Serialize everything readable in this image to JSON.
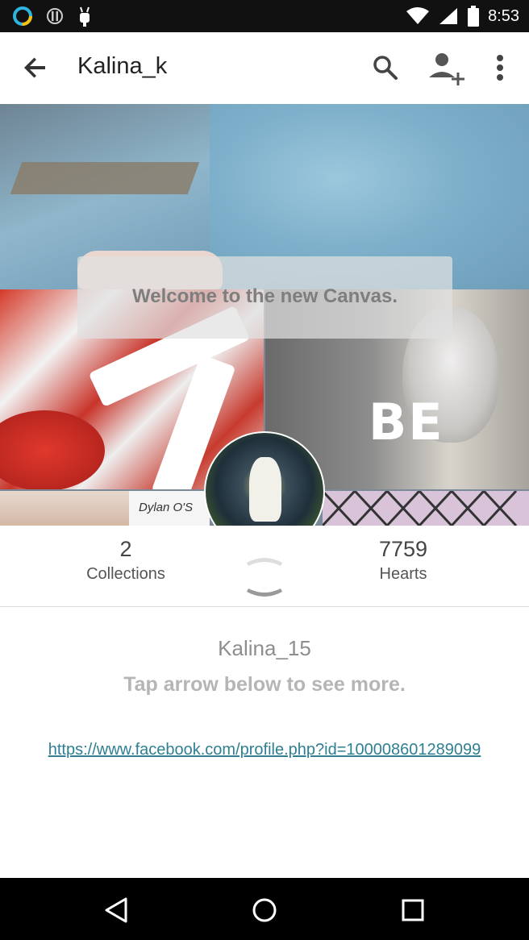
{
  "status_bar": {
    "time": "8:53",
    "icons": [
      "assistant-ring-icon",
      "sync-alert-icon",
      "android-debug-icon",
      "wifi-icon",
      "signal-icon",
      "battery-icon"
    ]
  },
  "app_bar": {
    "title": "Kalina_k",
    "icons": [
      "back-arrow-icon",
      "search-icon",
      "add-user-icon",
      "more-vert-icon"
    ]
  },
  "cover": {
    "overlay_text": "Welcome to the new Canvas.",
    "collage_texts": [
      "BE",
      "Dylan O'S"
    ]
  },
  "stats": {
    "collections_count": "2",
    "collections_label": "Collections",
    "hearts_count": "7759",
    "hearts_label": "Hearts"
  },
  "bio": {
    "username": "Kalina_15",
    "hint": "Tap arrow below to see more.",
    "link": "https://www.facebook.com/profile.php?id=100008601289099"
  },
  "nav_bar": {
    "icons": [
      "back-triangle-icon",
      "home-circle-icon",
      "recents-square-icon"
    ]
  },
  "colors": {
    "link": "#2f7f93",
    "status_bar": "#111111",
    "nav_bar": "#000000"
  }
}
